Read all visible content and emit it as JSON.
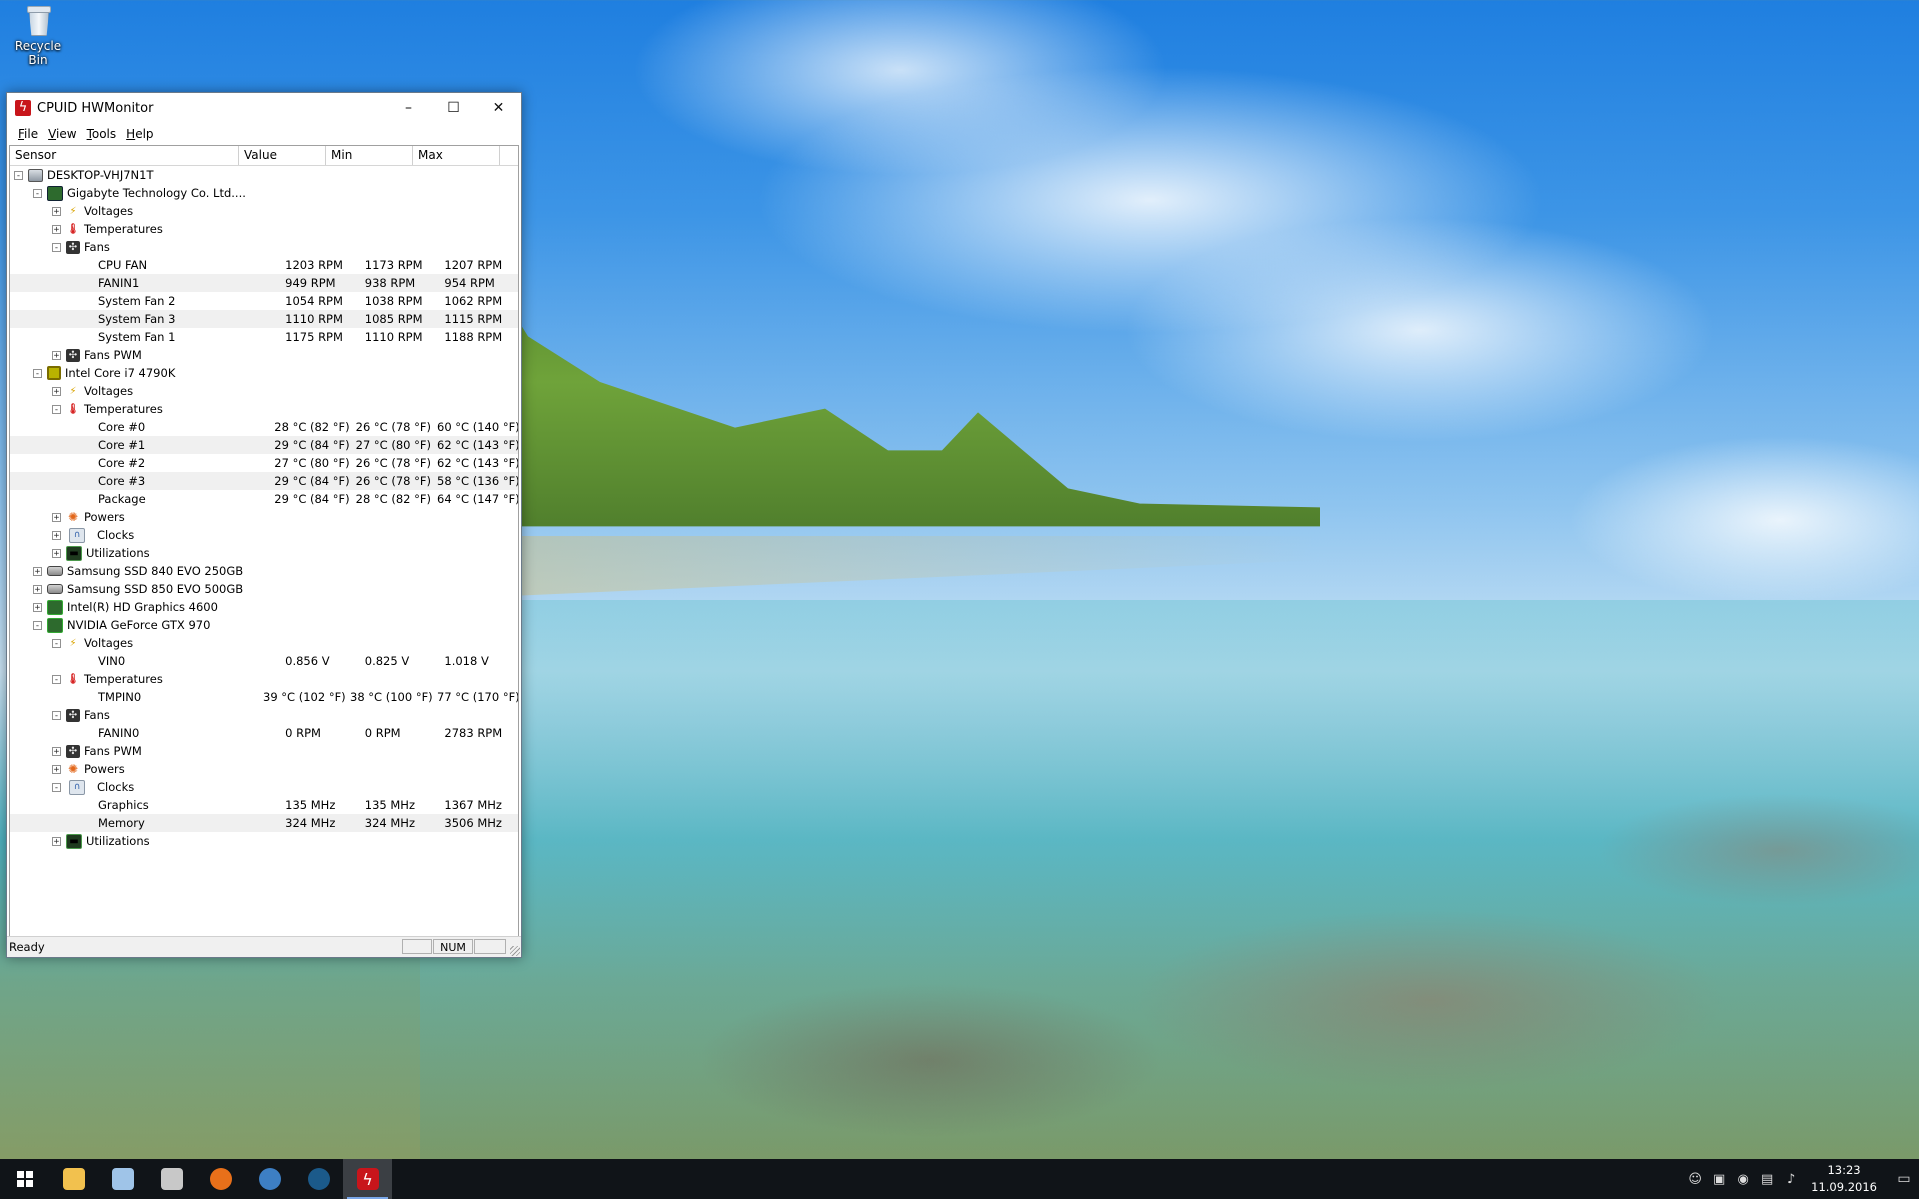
{
  "desktop": {
    "icon_label": "Recycle Bin"
  },
  "window": {
    "title": "CPUID HWMonitor",
    "min_glyph": "–",
    "max_glyph": "☐",
    "close_glyph": "✕"
  },
  "menu": [
    "File",
    "View",
    "Tools",
    "Help"
  ],
  "columns": [
    "Sensor",
    "Value",
    "Min",
    "Max"
  ],
  "rows": [
    {
      "level": 0,
      "exp": "-",
      "icon": "computer",
      "name": "DESKTOP-VHJ7N1T"
    },
    {
      "level": 1,
      "exp": "-",
      "icon": "board",
      "name": "Gigabyte Technology Co. Ltd...."
    },
    {
      "level": 2,
      "exp": "+",
      "icon": "volt",
      "name": "Voltages"
    },
    {
      "level": 2,
      "exp": "+",
      "icon": "temp",
      "name": "Temperatures"
    },
    {
      "level": 2,
      "exp": "-",
      "icon": "fan",
      "name": "Fans"
    },
    {
      "level": 3,
      "leaf": true,
      "name": "CPU FAN",
      "value": "1203 RPM",
      "min": "1173 RPM",
      "max": "1207 RPM"
    },
    {
      "level": 3,
      "leaf": true,
      "name": "FANIN1",
      "value": "949 RPM",
      "min": "938 RPM",
      "max": "954 RPM"
    },
    {
      "level": 3,
      "leaf": true,
      "name": "System Fan 2",
      "value": "1054 RPM",
      "min": "1038 RPM",
      "max": "1062 RPM"
    },
    {
      "level": 3,
      "leaf": true,
      "name": "System Fan 3",
      "value": "1110 RPM",
      "min": "1085 RPM",
      "max": "1115 RPM"
    },
    {
      "level": 3,
      "leaf": true,
      "name": "System Fan 1",
      "value": "1175 RPM",
      "min": "1110 RPM",
      "max": "1188 RPM"
    },
    {
      "level": 2,
      "exp": "+",
      "icon": "fan",
      "name": "Fans PWM"
    },
    {
      "level": 1,
      "exp": "-",
      "icon": "cpu",
      "name": "Intel Core i7 4790K"
    },
    {
      "level": 2,
      "exp": "+",
      "icon": "volt",
      "name": "Voltages"
    },
    {
      "level": 2,
      "exp": "-",
      "icon": "temp",
      "name": "Temperatures"
    },
    {
      "level": 3,
      "leaf": true,
      "name": "Core #0",
      "value": "28 °C  (82 °F)",
      "min": "26 °C  (78 °F)",
      "max": "60 °C  (140 °F)"
    },
    {
      "level": 3,
      "leaf": true,
      "name": "Core #1",
      "value": "29 °C  (84 °F)",
      "min": "27 °C  (80 °F)",
      "max": "62 °C  (143 °F)"
    },
    {
      "level": 3,
      "leaf": true,
      "name": "Core #2",
      "value": "27 °C  (80 °F)",
      "min": "26 °C  (78 °F)",
      "max": "62 °C  (143 °F)"
    },
    {
      "level": 3,
      "leaf": true,
      "name": "Core #3",
      "value": "29 °C  (84 °F)",
      "min": "26 °C  (78 °F)",
      "max": "58 °C  (136 °F)"
    },
    {
      "level": 3,
      "leaf": true,
      "name": "Package",
      "value": "29 °C  (84 °F)",
      "min": "28 °C  (82 °F)",
      "max": "64 °C  (147 °F)"
    },
    {
      "level": 2,
      "exp": "+",
      "icon": "power",
      "name": "Powers"
    },
    {
      "level": 2,
      "exp": "+",
      "icon": "clock",
      "name": "Clocks"
    },
    {
      "level": 2,
      "exp": "+",
      "icon": "util",
      "name": "Utilizations"
    },
    {
      "level": 1,
      "exp": "+",
      "icon": "ssd",
      "name": "Samsung SSD 840 EVO 250GB"
    },
    {
      "level": 1,
      "exp": "+",
      "icon": "ssd",
      "name": "Samsung SSD 850 EVO 500GB"
    },
    {
      "level": 1,
      "exp": "+",
      "icon": "gpu",
      "name": "Intel(R) HD Graphics 4600"
    },
    {
      "level": 1,
      "exp": "-",
      "icon": "gpu",
      "name": "NVIDIA GeForce GTX 970"
    },
    {
      "level": 2,
      "exp": "-",
      "icon": "volt",
      "name": "Voltages"
    },
    {
      "level": 3,
      "leaf": true,
      "name": "VIN0",
      "value": "0.856 V",
      "min": "0.825 V",
      "max": "1.018 V"
    },
    {
      "level": 2,
      "exp": "-",
      "icon": "temp",
      "name": "Temperatures"
    },
    {
      "level": 3,
      "leaf": true,
      "name": "TMPIN0",
      "value": "39 °C  (102 °F)",
      "min": "38 °C  (100 °F)",
      "max": "77 °C  (170 °F)"
    },
    {
      "level": 2,
      "exp": "-",
      "icon": "fan",
      "name": "Fans"
    },
    {
      "level": 3,
      "leaf": true,
      "name": "FANIN0",
      "value": "0 RPM",
      "min": "0 RPM",
      "max": "2783 RPM"
    },
    {
      "level": 2,
      "exp": "+",
      "icon": "fan",
      "name": "Fans PWM"
    },
    {
      "level": 2,
      "exp": "+",
      "icon": "power",
      "name": "Powers"
    },
    {
      "level": 2,
      "exp": "-",
      "icon": "clock",
      "name": "Clocks"
    },
    {
      "level": 3,
      "leaf": true,
      "name": "Graphics",
      "value": "135 MHz",
      "min": "135 MHz",
      "max": "1367 MHz"
    },
    {
      "level": 3,
      "leaf": true,
      "name": "Memory",
      "value": "324 MHz",
      "min": "324 MHz",
      "max": "3506 MHz"
    },
    {
      "level": 2,
      "exp": "+",
      "icon": "util",
      "name": "Utilizations"
    }
  ],
  "status": {
    "text": "Ready",
    "num": "NUM"
  },
  "taskbar": {
    "items": [
      {
        "name": "start",
        "color": "#ffffff"
      },
      {
        "name": "file-explorer",
        "color": "#f2c14e"
      },
      {
        "name": "notepad",
        "color": "#9fc4e8"
      },
      {
        "name": "settings-tool",
        "color": "#c8c8c8"
      },
      {
        "name": "firefox",
        "color": "#e8701a"
      },
      {
        "name": "thunderbird",
        "color": "#3d7fc4"
      },
      {
        "name": "steam",
        "color": "#1b5a8a"
      },
      {
        "name": "hwmonitor",
        "color": "#c8151b",
        "active": true
      }
    ],
    "time": "13:23",
    "date": "11.09.2016"
  },
  "icon_glyphs": {
    "volt": "⚡",
    "temp": "🌡",
    "fan": "✣",
    "power": "✺",
    "clock": "∩",
    "util": "▬"
  }
}
